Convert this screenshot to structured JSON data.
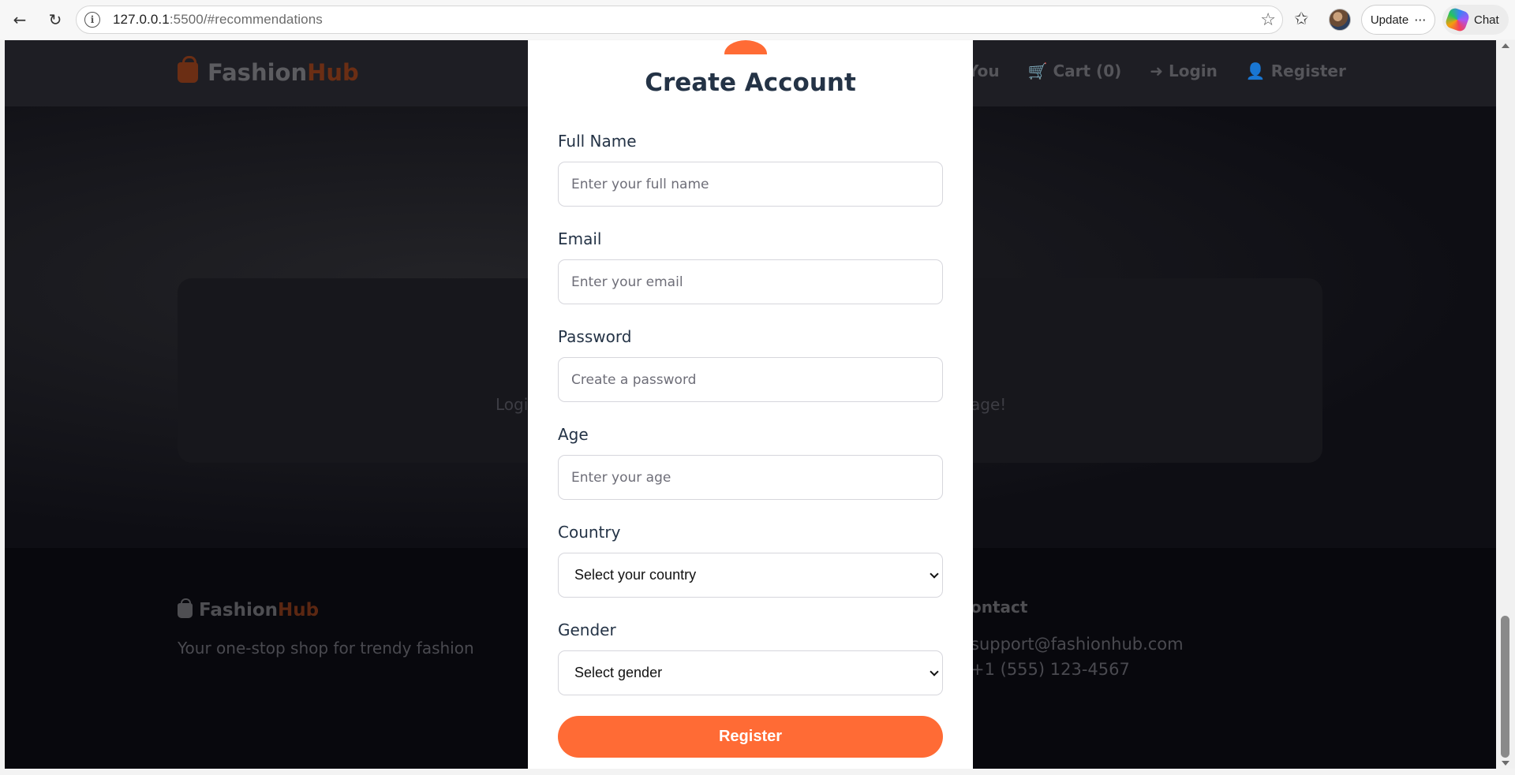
{
  "browser": {
    "url_host": "127.0.0.1",
    "url_path": ":5500/#recommendations",
    "update_label": "Update",
    "chat_label": "Chat"
  },
  "site": {
    "logo_main": "Fashion",
    "logo_accent": "Hub",
    "nav": {
      "partial": "You",
      "cart": "Cart (0)",
      "login": "Login",
      "register": "Register"
    },
    "recommendation_left": "Logi",
    "recommendation_right": "age!",
    "footer": {
      "logo_main": "Fashion",
      "logo_accent": "Hub",
      "tagline": "Your one-stop shop for trendy fashion",
      "contact_heading": "ontact",
      "email": "support@fashionhub.com",
      "phone": "+1 (555) 123-4567"
    }
  },
  "modal": {
    "title": "Create Account",
    "fields": {
      "full_name": {
        "label": "Full Name",
        "placeholder": "Enter your full name"
      },
      "email": {
        "label": "Email",
        "placeholder": "Enter your email"
      },
      "password": {
        "label": "Password",
        "placeholder": "Create a password"
      },
      "age": {
        "label": "Age",
        "placeholder": "Enter your age"
      },
      "country": {
        "label": "Country",
        "selected": "Select your country"
      },
      "gender": {
        "label": "Gender",
        "selected": "Select gender"
      }
    },
    "submit_label": "Register"
  },
  "colors": {
    "accent": "#ff6b35",
    "heading": "#243346"
  }
}
